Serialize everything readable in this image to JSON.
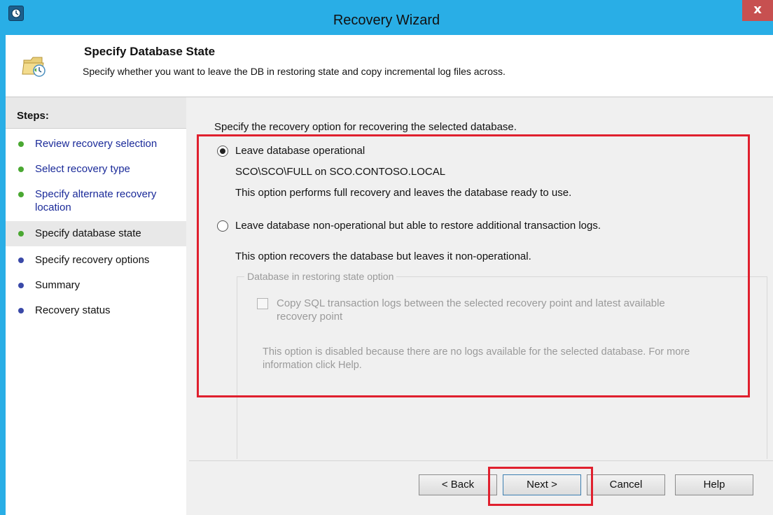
{
  "window": {
    "title": "Recovery Wizard",
    "close_glyph": "x",
    "app_icon": "wizard-clock-icon"
  },
  "header": {
    "title": "Specify Database State",
    "description": "Specify whether you want to leave the DB in restoring state and copy incremental log files across.",
    "icon": "folder-clock-icon"
  },
  "steps": {
    "heading": "Steps:",
    "items": [
      {
        "label": "Review recovery selection",
        "status": "done",
        "link": true
      },
      {
        "label": "Select recovery type",
        "status": "done",
        "link": true
      },
      {
        "label": "Specify alternate recovery location",
        "status": "done",
        "link": true
      },
      {
        "label": "Specify database state",
        "status": "done",
        "link": false,
        "current": true
      },
      {
        "label": "Specify recovery options",
        "status": "pending",
        "link": false
      },
      {
        "label": "Summary",
        "status": "pending",
        "link": false
      },
      {
        "label": "Recovery status",
        "status": "pending",
        "link": false
      }
    ]
  },
  "main": {
    "intro": "Specify the recovery option for recovering the selected database.",
    "option1": {
      "label": "Leave database operational",
      "selected": true,
      "path": "SCO\\SCO\\FULL on SCO.CONTOSO.LOCAL",
      "description": "This option performs full recovery and leaves the database ready to use."
    },
    "option2": {
      "label": "Leave database non-operational but able to restore additional transaction logs.",
      "selected": false,
      "description": "This option recovers the database but leaves it non-operational."
    },
    "group": {
      "legend": "Database in restoring state option",
      "checkbox_line1": "Copy SQL transaction logs between the selected recovery point and latest available",
      "checkbox_line2": "recovery point",
      "checkbox_checked": false,
      "note_line1": "This option is disabled because there are no logs available for the selected database. For more",
      "note_line2": "information click Help."
    }
  },
  "buttons": {
    "back": "< Back",
    "next": "Next >",
    "cancel": "Cancel",
    "help": "Help"
  },
  "colors": {
    "frame": "#29aee6",
    "highlight": "#e0202e",
    "done_bullet": "#4aa832",
    "pending_bullet": "#3a49a8",
    "link": "#1a2a99"
  }
}
